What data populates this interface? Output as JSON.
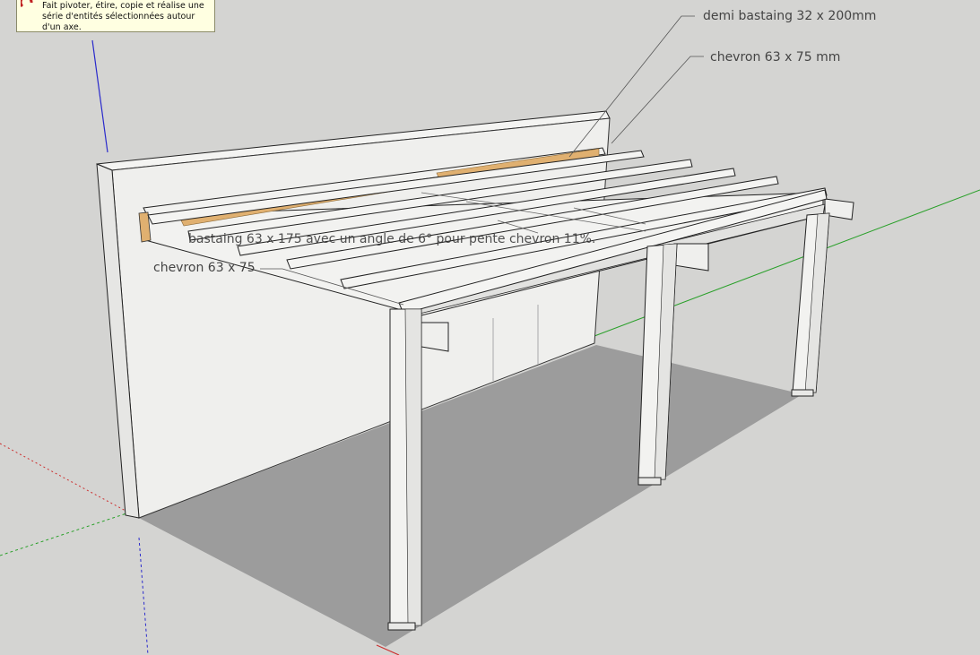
{
  "tooltip": {
    "text": "Fait pivoter, étire, copie et réalise une\nsérie d'entités sélectionnées autour\nd'un axe.",
    "icon": "rotate-tool-icon"
  },
  "labels": {
    "demi_bastaing": "demi bastaing 32 x 200mm",
    "chevron_top": "chevron 63 x 75 mm",
    "bastaing": "bastaing 63 x 175 avec un angle de 6° pour pente chevron 11%.",
    "chevron_left": "chevron 63 x 75"
  },
  "colors": {
    "background": "#d4d4d2",
    "ground_shadow": "#9c9c9c",
    "timber": "#f2f2f0",
    "timber_shade": "#dcdcda",
    "plank": "#e0b070",
    "axis_green": "#2aa02a",
    "axis_blue": "#2a2acc",
    "axis_red": "#cc3030"
  }
}
